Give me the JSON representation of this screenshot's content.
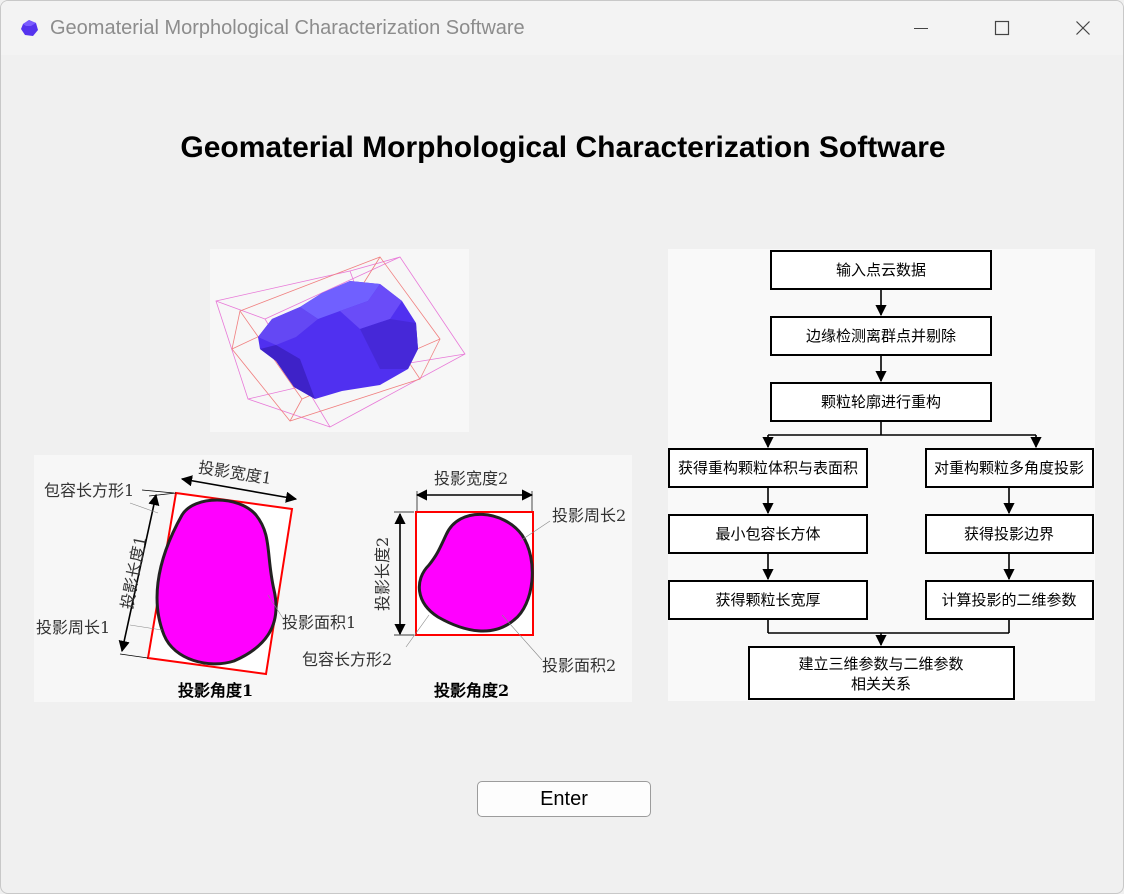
{
  "window": {
    "title": "Geomaterial Morphological Characterization Software",
    "controls": [
      "minimize-icon",
      "maximize-icon",
      "close-icon"
    ]
  },
  "main": {
    "heading": "Geomaterial Morphological Characterization Software",
    "enter_label": "Enter"
  },
  "projection_figure": {
    "left": {
      "width_label": "投影宽度1",
      "box_label": "包容长方形1",
      "length_label": "投影长度1",
      "perimeter_label": "投影周长1",
      "area_label": "投影面积1",
      "caption": "投影角度1"
    },
    "right": {
      "width_label": "投影宽度2",
      "perimeter_label": "投影周长2",
      "length_label": "投影长度2",
      "box_label": "包容长方形2",
      "area_label": "投影面积2",
      "caption": "投影角度2"
    }
  },
  "flowchart": {
    "steps": [
      "输入点云数据",
      "边缘检测离群点并剔除",
      "颗粒轮廓进行重构"
    ],
    "left_branch": [
      "获得重构颗粒体积与表面积",
      "最小包容长方体",
      "获得颗粒长宽厚"
    ],
    "right_branch": [
      "对重构颗粒多角度投影",
      "获得投影边界",
      "计算投影的二维参数"
    ],
    "final": [
      "建立三维参数与二维参数",
      "相关关系"
    ]
  },
  "colors": {
    "rock": "#5533ee",
    "projection_fill": "#ff00ff",
    "bounding_box": "#ff0000"
  }
}
